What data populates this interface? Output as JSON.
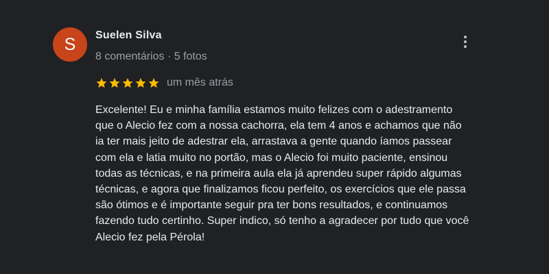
{
  "reviewer": {
    "avatar_letter": "S",
    "avatar_color": "#c8441a",
    "name": "Suelen Silva",
    "meta": "8 comentários · 5 fotos"
  },
  "more_menu_icon": "more-vert-icon",
  "rating": {
    "stars": 5,
    "max_stars": 5,
    "star_color": "#fbbc04",
    "date": "um mês atrás"
  },
  "review": {
    "lines": [
      "Excelente! Eu e minha família estamos muito felizes com o adestramento",
      "que o Alecio fez com a nossa cachorra, ela tem 4 anos e achamos que não",
      "ia ter mais jeito de adestrar ela, arrastava a gente quando íamos passear",
      "com ela e latia muito no portão, mas o Alecio foi muito paciente, ensinou",
      "todas as técnicas, e na primeira aula ela já aprendeu super rápido algumas",
      "técnicas, e agora que finalizamos ficou perfeito, os exercícios que ele passa",
      "são ótimos e é importante seguir pra ter bons resultados, e continuamos",
      "fazendo tudo certinho. Super indico, só tenho a agradecer por tudo que você",
      "Alecio fez pela Pérola!"
    ]
  }
}
